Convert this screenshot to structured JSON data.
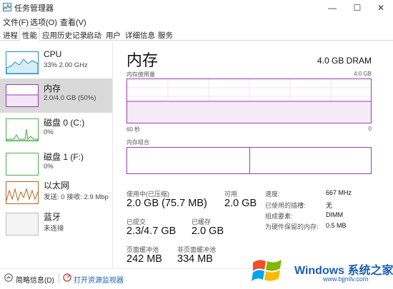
{
  "window": {
    "title": "任务管理器",
    "min": "—",
    "max": "☐",
    "close": "✕"
  },
  "menu": [
    "文件(F)",
    "选项(O)",
    "查看(V)"
  ],
  "tabs": [
    "进程",
    "性能",
    "应用历史记录",
    "启动",
    "用户",
    "详细信息",
    "服务"
  ],
  "active_tab": "性能",
  "resources": [
    {
      "name": "CPU",
      "sub": "33%  2.00 GHz",
      "color": "#1e8fcf",
      "selected": false
    },
    {
      "name": "内存",
      "sub": "2.0/4.0 GB (50%)",
      "color": "#9b3bb0",
      "selected": true
    },
    {
      "name": "磁盘 0 (C:)",
      "sub": "0%",
      "color": "#4caf50",
      "selected": false
    },
    {
      "name": "磁盘 1 (F:)",
      "sub": "0%",
      "color": "#4caf50",
      "selected": false
    },
    {
      "name": "以太网",
      "sub": "发送: 0  接收: 2.9 Mbp",
      "color": "#b5651d",
      "selected": false
    },
    {
      "name": "蓝牙",
      "sub": "未连接",
      "color": "#9e9e9e",
      "selected": false
    }
  ],
  "main": {
    "title": "内存",
    "spec": "4.0 GB DRAM",
    "usage_label": "内存使用量",
    "usage_max": "4.0 GB",
    "time_left": "60 秒",
    "time_right": "0",
    "usage_fraction": 0.5,
    "composition_label": "内存组合",
    "in_use_fraction": 0.5
  },
  "stats": {
    "in_use_label": "使用中(已压缩)",
    "in_use_value": "2.0 GB (75.7 MB)",
    "available_label": "可用",
    "available_value": "2.0 GB",
    "committed_label": "已提交",
    "committed_value": "2.3/4.7 GB",
    "cached_label": "已缓存",
    "cached_value": "2.0 GB",
    "paged_label": "页面缓冲池",
    "paged_value": "242 MB",
    "nonpaged_label": "非页面缓冲池",
    "nonpaged_value": "334 MB"
  },
  "details": [
    {
      "label": "速度:",
      "value": "667 MHz"
    },
    {
      "label": "已使用的插槽:",
      "value": "无"
    },
    {
      "label": "组成要素:",
      "value": "DIMM"
    },
    {
      "label": "为硬件保留的内存:",
      "value": "0.5 MB"
    }
  ],
  "bottom": {
    "summary": "简略信息(D)",
    "open_monitor": "打开资源监视器"
  },
  "watermark": {
    "title": "Windows 系统之家",
    "url": "www.bjjmlv.com"
  }
}
